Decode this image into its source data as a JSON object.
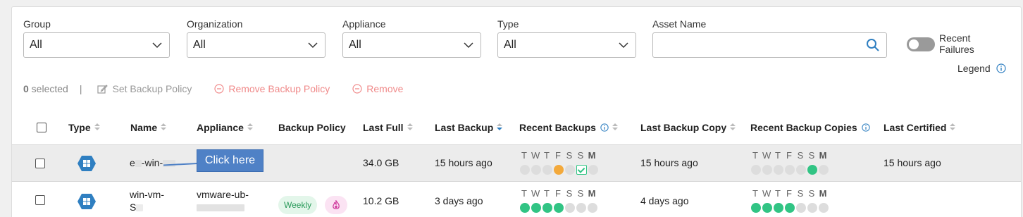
{
  "filters": {
    "group": {
      "label": "Group",
      "value": "All"
    },
    "organization": {
      "label": "Organization",
      "value": "All"
    },
    "appliance": {
      "label": "Appliance",
      "value": "All"
    },
    "type": {
      "label": "Type",
      "value": "All"
    },
    "asset_name": {
      "label": "Asset Name",
      "value": ""
    },
    "recent_failures": {
      "label": "Recent Failures",
      "enabled": false
    }
  },
  "legend_label": "Legend",
  "toolbar": {
    "selected_count": "0",
    "selected_suffix": " selected",
    "separator": "|",
    "set_backup_policy": "Set Backup Policy",
    "remove_backup_policy": "Remove Backup Policy",
    "remove": "Remove"
  },
  "table": {
    "columns": [
      {
        "key": "type",
        "label": "Type"
      },
      {
        "key": "name",
        "label": "Name"
      },
      {
        "key": "appliance",
        "label": "Appliance"
      },
      {
        "key": "backup_policy",
        "label": "Backup Policy"
      },
      {
        "key": "last_full",
        "label": "Last Full"
      },
      {
        "key": "last_backup",
        "label": "Last Backup"
      },
      {
        "key": "recent_backups",
        "label": "Recent Backups"
      },
      {
        "key": "last_backup_copy",
        "label": "Last Backup Copy"
      },
      {
        "key": "recent_backup_copies",
        "label": "Recent Backup Copies"
      },
      {
        "key": "last_certified",
        "label": "Last Certified"
      }
    ],
    "day_labels": [
      "T",
      "W",
      "T",
      "F",
      "S",
      "S",
      "M"
    ],
    "rows": [
      {
        "type_icon": "windows-vm-icon",
        "name_prefix": "e",
        "name_mid": "-win-",
        "appliance": "",
        "backup_policy": "",
        "last_full": "34.0 GB",
        "last_backup": "15 hours ago",
        "recent_backups": [
          "none",
          "none",
          "none",
          "warning",
          "none",
          "certified",
          "none"
        ],
        "last_backup_copy": "15 hours ago",
        "recent_backup_copies": [
          "none",
          "none",
          "none",
          "none",
          "none",
          "success",
          "none"
        ],
        "last_certified": "15 hours ago"
      },
      {
        "type_icon": "windows-vm-icon",
        "name_line1": "win-vm-",
        "name_line2": "S",
        "appliance": "vmware-ub-",
        "backup_policy": "Weekly",
        "policy_icon": "flame-icon",
        "last_full": "10.2 GB",
        "last_backup": "3 days ago",
        "recent_backups": [
          "success",
          "success",
          "success",
          "success",
          "none",
          "none",
          "none"
        ],
        "last_backup_copy": "4 days ago",
        "recent_backup_copies": [
          "success",
          "success",
          "success",
          "success",
          "none",
          "none",
          "none"
        ],
        "last_certified": ""
      }
    ]
  },
  "callout": {
    "text": "Click here"
  },
  "colors": {
    "success": "#31c484",
    "warning": "#f3a93b",
    "empty": "#dddddd",
    "accent": "#2f7fc1",
    "danger_text": "#f08a8a",
    "callout": "#4f81c6"
  }
}
